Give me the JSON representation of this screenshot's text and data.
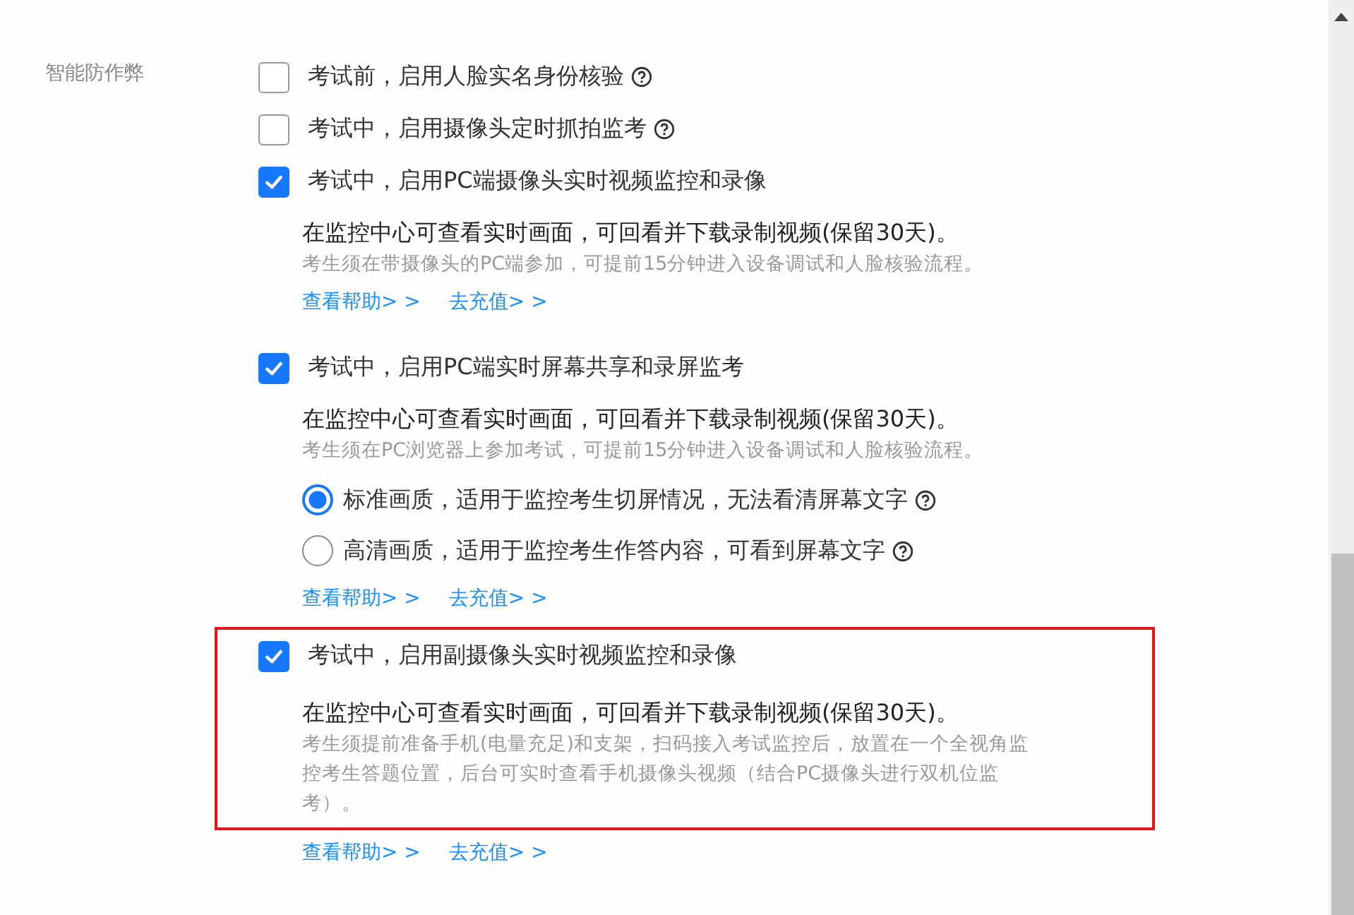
{
  "section_label": "智能防作弊",
  "options": [
    {
      "label": "考试前，启用人脸实名身份核验",
      "checked": false,
      "help": true,
      "highlighted": false
    },
    {
      "label": "考试中，启用摄像头定时抓拍监考",
      "checked": false,
      "help": true,
      "highlighted": false
    },
    {
      "label": "考试中，启用PC端摄像头实时视频监控和录像",
      "checked": true,
      "help": false,
      "highlighted": false,
      "detail": "在监控中心可查看实时画面，可回看并下载录制视频(保留30天)。",
      "note": "考生须在带摄像头的PC端参加，可提前15分钟进入设备调试和人脸核验流程。",
      "links": [
        "查看帮助> >",
        "去充值> >"
      ]
    },
    {
      "label": "考试中，启用PC端实时屏幕共享和录屏监考",
      "checked": true,
      "help": false,
      "highlighted": false,
      "detail": "在监控中心可查看实时画面，可回看并下载录制视频(保留30天)。",
      "note": "考生须在PC浏览器上参加考试，可提前15分钟进入设备调试和人脸核验流程。",
      "qualities": [
        {
          "label": "标准画质，适用于监控考生切屏情况，无法看清屏幕文字",
          "selected": true
        },
        {
          "label": "高清画质，适用于监控考生作答内容，可看到屏幕文字",
          "selected": false
        }
      ],
      "links": [
        "查看帮助> >",
        "去充值> >"
      ]
    },
    {
      "label": "考试中，启用副摄像头实时视频监控和录像",
      "checked": true,
      "help": false,
      "highlighted": true,
      "detail": "在监控中心可查看实时画面，可回看并下载录制视频(保留30天)。",
      "note": "考生须提前准备手机(电量充足)和支架，扫码接入考试监控后，放置在一个全视角监控考生答题位置，后台可实时查看手机摄像头视频（结合PC摄像头进行双机位监考）。",
      "links": [
        "查看帮助> >",
        "去充值> >"
      ]
    }
  ]
}
